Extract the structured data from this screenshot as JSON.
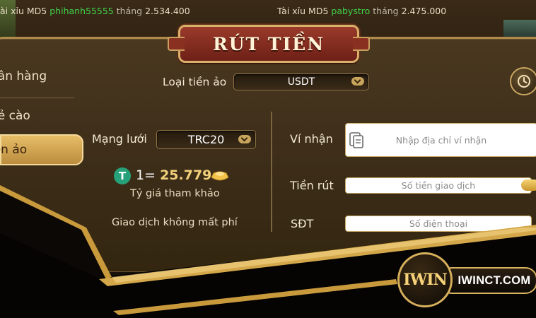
{
  "ticker": [
    {
      "game": "ài xỉu MD5",
      "user": "phihanh55555",
      "month": "tháng",
      "amount": "2.534.400"
    },
    {
      "game": "Tài xỉu MD5",
      "user": "pabystro",
      "month": "tháng",
      "amount": "2.475.000"
    }
  ],
  "title": "RÚT TIỀN",
  "sidebar": {
    "items": [
      {
        "label": "gân hàng"
      },
      {
        "label": "hẻ cào"
      },
      {
        "label": "iền ảo"
      }
    ]
  },
  "currency": {
    "label": "Loại tiền ảo",
    "value": "USDT"
  },
  "network": {
    "label": "Mạng lưới",
    "value": "TRC20"
  },
  "rate": {
    "prefix": "1=",
    "value": "25.779",
    "caption": "Tỷ giá tham khảo"
  },
  "fee_note": "Giao dịch không mất phí",
  "form": {
    "wallet_label": "Ví nhận",
    "wallet_placeholder": "Nhập địa chỉ ví nhận",
    "amount_label": "Tiền rút",
    "amount_placeholder": "Số tiền giao dịch",
    "phone_label": "SĐT",
    "phone_placeholder": "Số điện thoại"
  },
  "logo": {
    "mark": "IWIN",
    "text": "IWINCT.COM"
  },
  "colors": {
    "gold": "#d7b05c",
    "panel": "#3b2c18",
    "green": "#3fd24a",
    "tether": "#27a17a"
  },
  "icons": [
    "history-icon",
    "clipboard-icon",
    "chevron-down-icon",
    "tether-icon",
    "gold-ingot-icon"
  ]
}
